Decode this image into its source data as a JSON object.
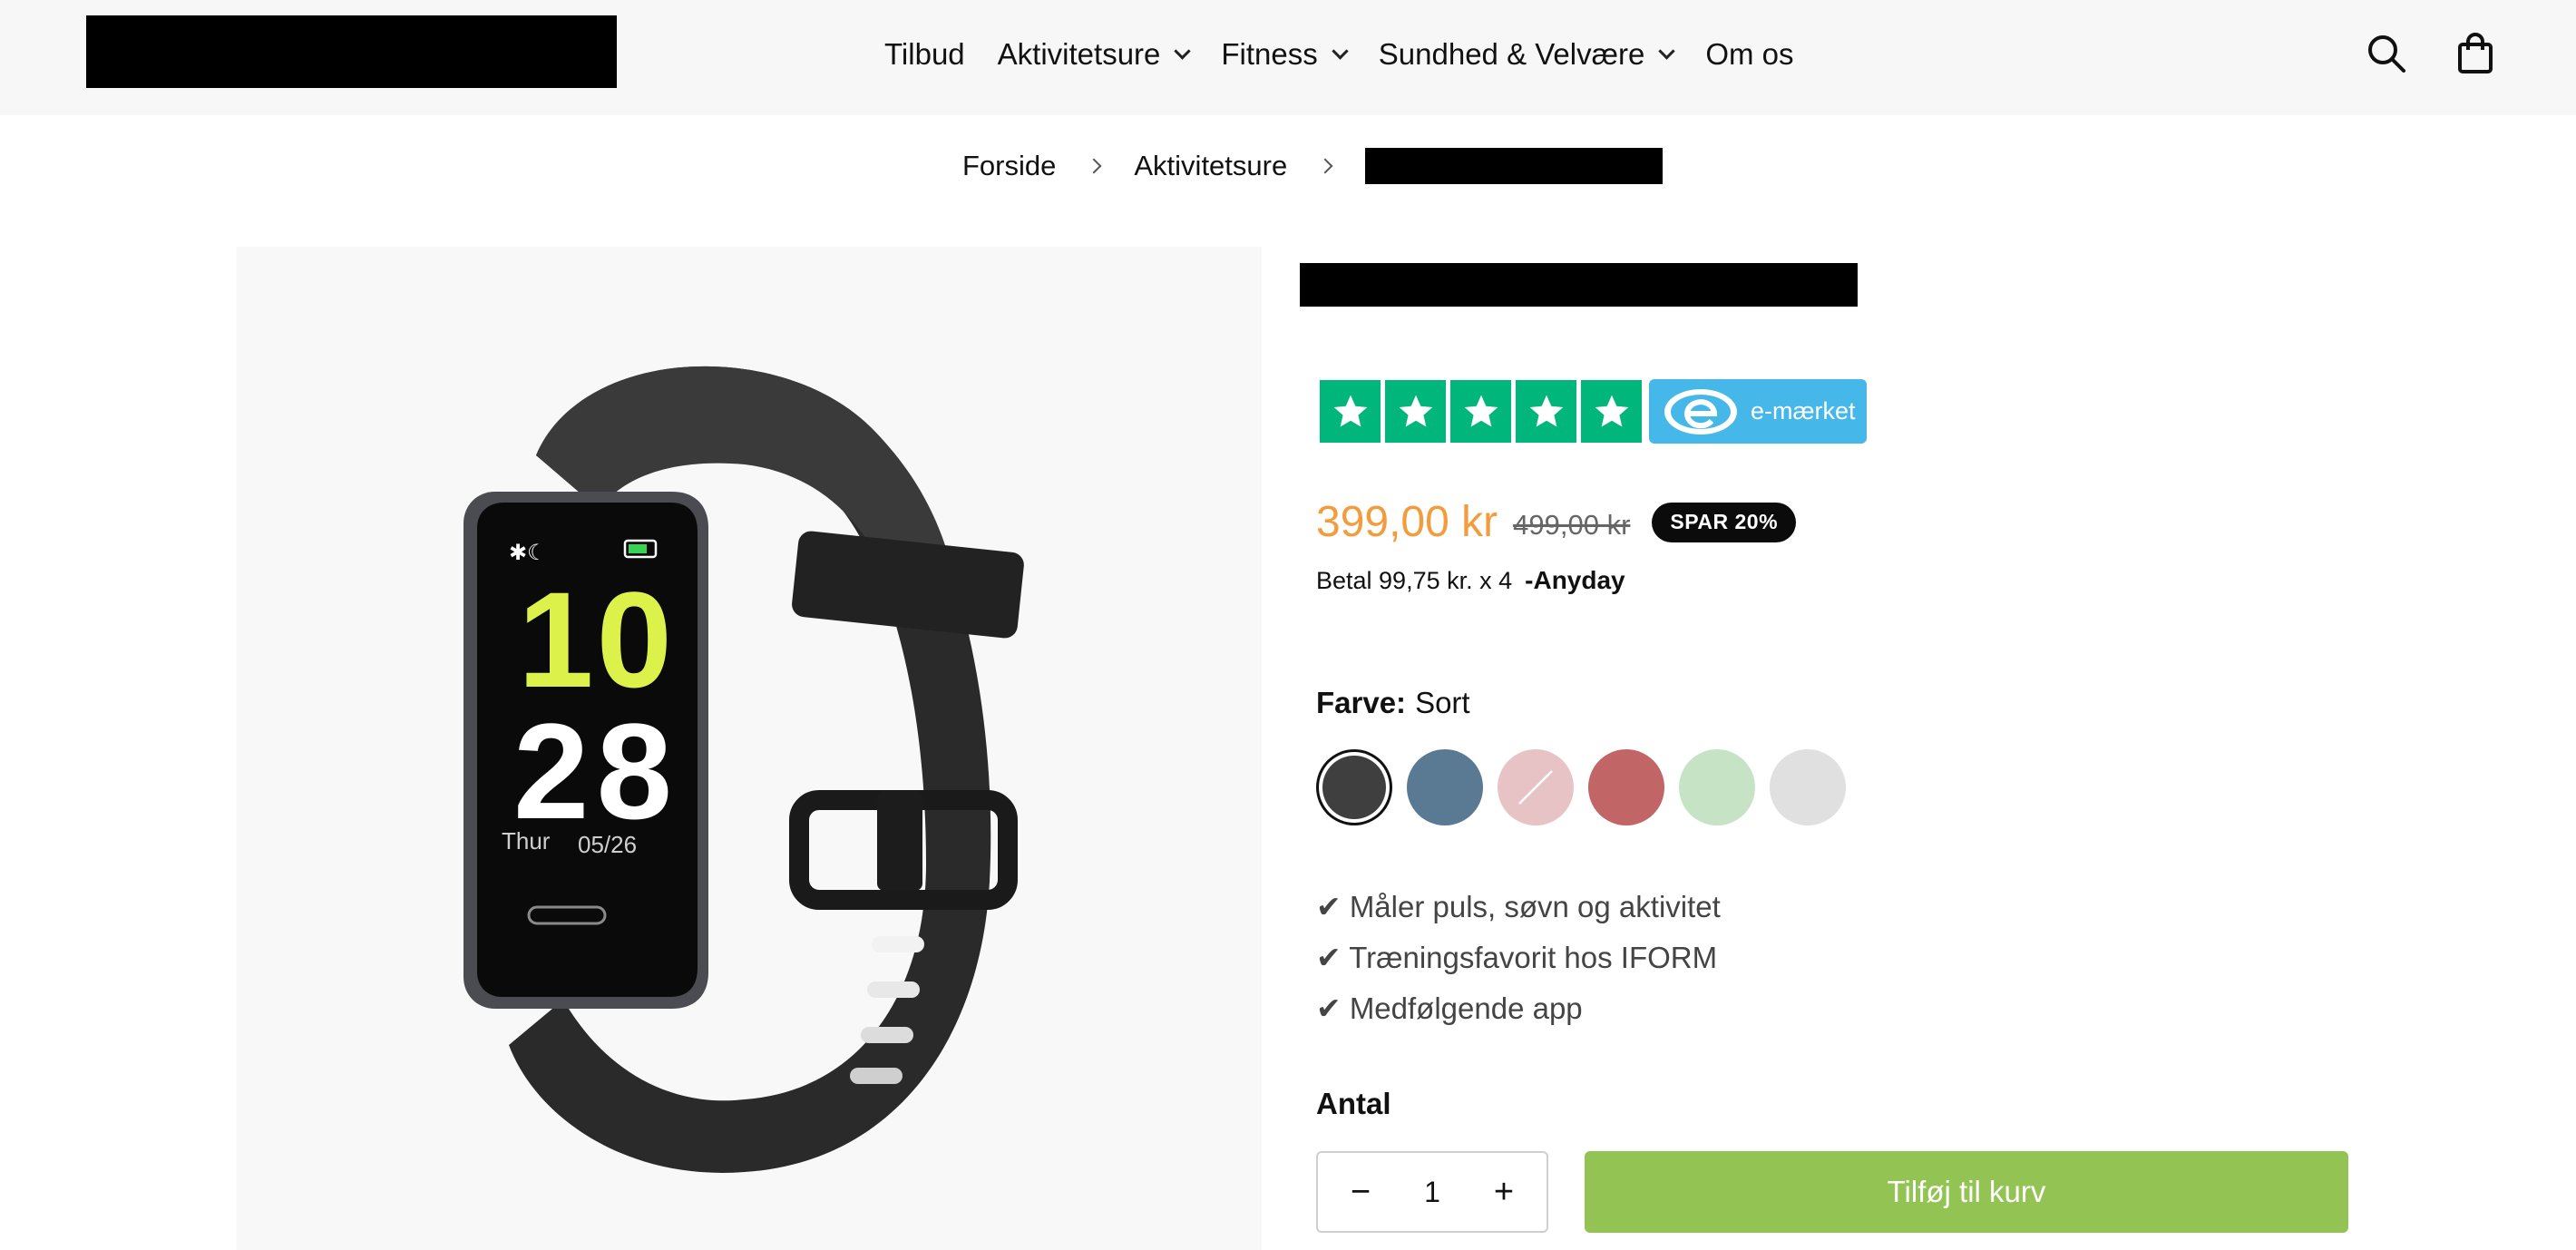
{
  "header": {
    "nav": [
      {
        "label": "Tilbud",
        "dropdown": false
      },
      {
        "label": "Aktivitetsure",
        "dropdown": true
      },
      {
        "label": "Fitness",
        "dropdown": true
      },
      {
        "label": "Sundhed & Velvære",
        "dropdown": true
      },
      {
        "label": "Om os",
        "dropdown": false
      }
    ],
    "icons": [
      "search-icon",
      "cart-icon"
    ]
  },
  "breadcrumb": {
    "home": "Forside",
    "category": "Aktivitetsure"
  },
  "product": {
    "image": {
      "watch_hour": "10",
      "watch_minute": "28",
      "watch_day": "Thur",
      "watch_date": "05/26"
    },
    "rating_stars": 5,
    "emaerket_label": "e-mærket",
    "price": "399,00 kr",
    "compare_price": "499,00 kr",
    "save_badge": "SPAR 20%",
    "installment_text": "Betal 99,75 kr. x 4",
    "installment_provider": "Anyday",
    "color_key": "Farve:",
    "color_value": "Sort",
    "swatches": [
      {
        "name": "Sort",
        "color": "#3f3f3f",
        "selected": true
      },
      {
        "name": "Blå",
        "color": "#5a7a94",
        "selected": false
      },
      {
        "name": "Pink",
        "color": "#e8c3c6",
        "selected": false
      },
      {
        "name": "Rød",
        "color": "#c16566",
        "selected": false
      },
      {
        "name": "Grøn",
        "color": "#c6e3c6",
        "selected": false
      },
      {
        "name": "Hvid",
        "color": "#e0e0e0",
        "selected": false
      }
    ],
    "features": [
      "✔ Måler puls, søvn og aktivitet",
      "✔ Træningsfavorit hos IFORM",
      "✔ Medfølgende app"
    ],
    "quantity_label": "Antal",
    "quantity_value": "1",
    "minus_label": "−",
    "plus_label": "+",
    "add_to_cart_label": "Tilføj til kurv"
  },
  "colors": {
    "price": "#f39c3d",
    "trustpilot_green": "#00b67a",
    "emaerket_blue": "#45b7e8",
    "add_to_cart_green": "#93c353"
  }
}
